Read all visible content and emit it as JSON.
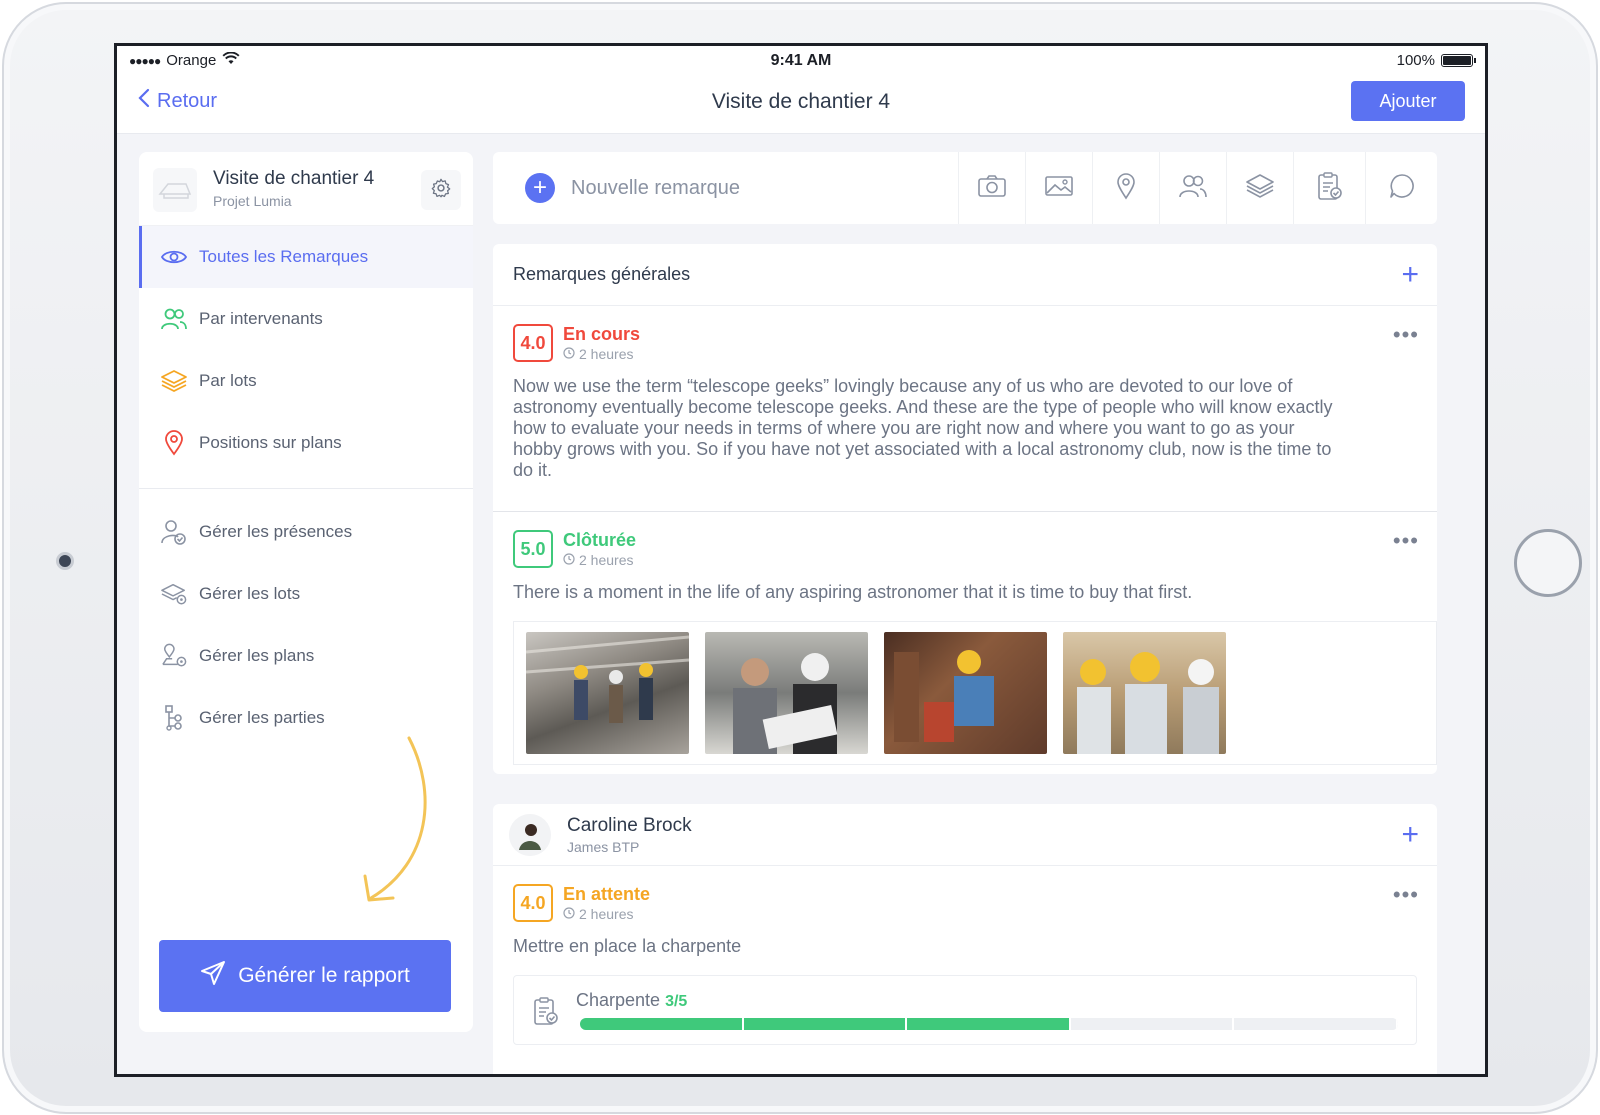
{
  "status_bar": {
    "signal": "●●●●●",
    "carrier": "Orange",
    "time": "9:41 AM",
    "battery": "100%"
  },
  "nav": {
    "back_label": "Retour",
    "title": "Visite de chantier 4",
    "add_label": "Ajouter"
  },
  "sidebar": {
    "project_title": "Visite de chantier 4",
    "project_subtitle": "Projet Lumia",
    "views": [
      {
        "label": "Toutes les Remarques",
        "icon": "eye-icon",
        "active": true
      },
      {
        "label": "Par intervenants",
        "icon": "users-icon"
      },
      {
        "label": "Par lots",
        "icon": "layers-icon"
      },
      {
        "label": "Positions sur plans",
        "icon": "map-pin-icon"
      }
    ],
    "manage": [
      {
        "label": "Gérer les présences",
        "icon": "user-check-icon"
      },
      {
        "label": "Gérer les lots",
        "icon": "layers-settings-icon"
      },
      {
        "label": "Gérer les plans",
        "icon": "map-settings-icon"
      },
      {
        "label": "Gérer les parties",
        "icon": "tree-icon"
      }
    ],
    "generate_label": "Générer le rapport"
  },
  "toolbar": {
    "new_remark_placeholder": "Nouvelle remarque",
    "tools": [
      "camera-icon",
      "image-icon",
      "location-icon",
      "people-icon",
      "layers-icon",
      "clipboard-check-icon",
      "comment-icon"
    ]
  },
  "general_section": {
    "title": "Remarques générales",
    "remarks": [
      {
        "score": "4.0",
        "status": "En cours",
        "status_color": "#f0493c",
        "time": "2 heures",
        "text": "Now we use the term “telescope geeks” lovingly because any of us who are devoted to our love of astronomy eventually become telescope geeks. And these are the type of people who will know exactly how to evaluate your needs in terms of where you are right now and where you want to go as your hobby grows with you. So if you have not yet associated with a local astronomy club, now is the time to do it."
      },
      {
        "score": "5.0",
        "status": "Clôturée",
        "status_color": "#3fc97b",
        "time": "2 heures",
        "text": "There is a moment in the life of any aspiring astronomer that it is time to buy that first.",
        "photos": 4
      }
    ]
  },
  "person_section": {
    "name": "Caroline Brock",
    "company": "James BTP",
    "remark": {
      "score": "4.0",
      "status": "En attente",
      "status_color": "#f5a623",
      "time": "2 heures",
      "text": "Mettre en place la charpente",
      "lot_label": "Charpente",
      "lot_count": "3/5",
      "progress": 0.6
    }
  },
  "colors": {
    "accent": "#5b72f2",
    "green": "#3fc97b",
    "red": "#f0493c",
    "orange": "#f5a623"
  }
}
